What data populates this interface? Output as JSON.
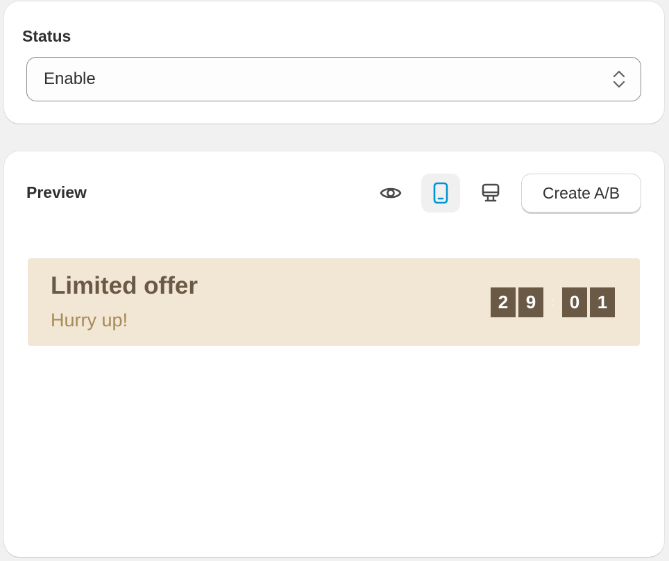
{
  "status_section": {
    "label": "Status",
    "select": {
      "value": "Enable"
    }
  },
  "preview_section": {
    "label": "Preview",
    "view_buttons": [
      {
        "icon": "eye-icon",
        "active": false
      },
      {
        "icon": "mobile-icon",
        "active": true
      },
      {
        "icon": "desktop-icon",
        "active": false
      }
    ],
    "create_ab_label": "Create A/B"
  },
  "banner": {
    "title": "Limited offer",
    "subtitle": "Hurry up!",
    "timer": {
      "minutes": [
        "2",
        "9"
      ],
      "separator": ":",
      "seconds": [
        "0",
        "1"
      ]
    }
  },
  "colors": {
    "banner_bg": "#f2e6d5",
    "banner_title": "#6a5a45",
    "banner_subtitle": "#a78a57",
    "active_icon": "#0094d5",
    "page_bg": "#f1f1f1"
  }
}
